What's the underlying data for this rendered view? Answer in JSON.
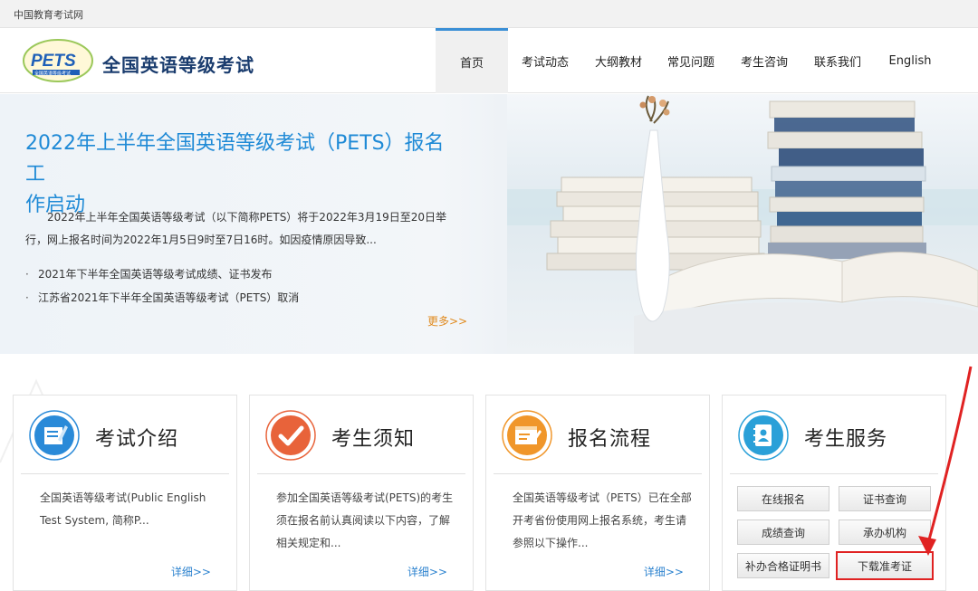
{
  "topbar": {
    "site_name": "中国教育考试网"
  },
  "header": {
    "logo_text": "PETS",
    "logo_subtext": "全国英语等级考试",
    "site_title": "全国英语等级考试",
    "nav": [
      "首页",
      "考试动态",
      "大纲教材",
      "常见问题",
      "考生咨询",
      "联系我们",
      "English"
    ],
    "active_nav": "首页"
  },
  "hero": {
    "title": "2022年上半年全国英语等级考试（PETS）报名工作启动",
    "title_line1": "2022年上半年全国英语等级考试（PETS）报名工",
    "title_line2": "作启动",
    "description": "2022年上半年全国英语等级考试（以下简称PETS）将于2022年3月19日至20日举行，网上报名时间为2022年1月5日9时至7日16时。如因疫情原因导致...",
    "links": [
      "2021年下半年全国英语等级考试成绩、证书发布",
      "江苏省2021年下半年全国英语等级考试（PETS）取消"
    ],
    "link_bullet": "·",
    "more": "更多>>"
  },
  "cards": [
    {
      "title": "考试介绍",
      "icon": "document-edit-icon",
      "color": "#2a8ad8",
      "text": "全国英语等级考试(Public English Test System, 简称P...",
      "more": "详细>>"
    },
    {
      "title": "考生须知",
      "icon": "checkmark-icon",
      "color": "#e8633a",
      "text": "参加全国英语等级考试(PETS)的考生须在报名前认真阅读以下内容，了解相关规定和...",
      "more": "详细>>"
    },
    {
      "title": "报名流程",
      "icon": "form-edit-icon",
      "color": "#f0962a",
      "text": "全国英语等级考试（PETS）已在全部开考省份使用网上报名系统，考生请参照以下操作...",
      "more": "详细>>"
    },
    {
      "title": "考生服务",
      "icon": "address-book-icon",
      "color": "#2aa0d8",
      "services": [
        "在线报名",
        "证书查询",
        "成绩查询",
        "承办机构",
        "补办合格证明书",
        "下载准考证"
      ],
      "highlighted": "下载准考证"
    }
  ],
  "annotation_color": "#e02222"
}
